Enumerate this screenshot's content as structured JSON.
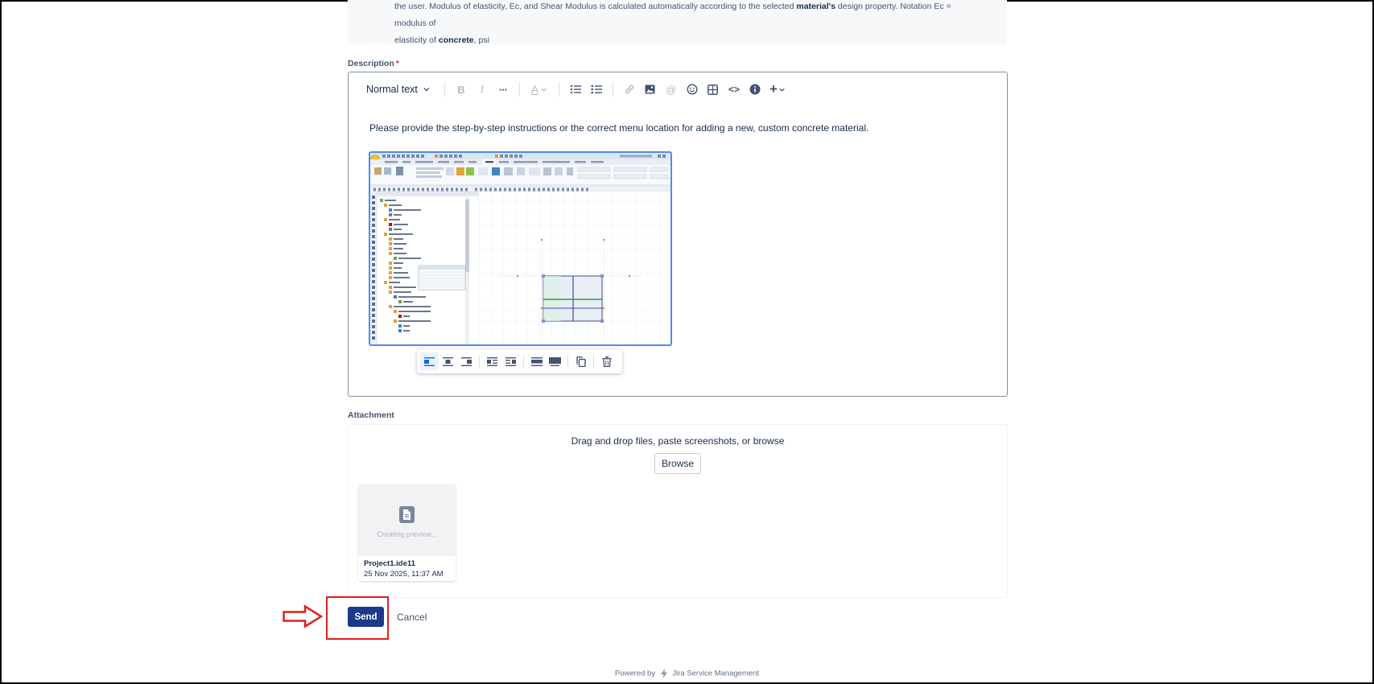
{
  "help": {
    "line1_pre": "the user. Modulus of elasticity, Ec, and Shear Modulus is calculated automatically according to the selected ",
    "line1_bold": "material's",
    "line1_post": " design property. Notation Ec = modulus of",
    "line2_pre": "elasticity of ",
    "line2_bold": "concrete",
    "line2_post": ", psi"
  },
  "description": {
    "label": "Description",
    "required_mark": "*",
    "toolbar": {
      "text_style": "Normal text",
      "bold": "B",
      "italic": "I",
      "more": "···",
      "text_color": "A",
      "mention": "@",
      "code": "<>",
      "insert": "+"
    },
    "body_text": "Please provide the step-by-step instructions or the correct menu location for adding a new, custom concrete material."
  },
  "attachment": {
    "label": "Attachment",
    "drop_text": "Drag and drop files, paste screenshots, or browse",
    "browse_label": "Browse",
    "file": {
      "preview_status": "Creating preview...",
      "name": "Project1.ide11",
      "date": "25 Nov 2025, 11:37 AM"
    }
  },
  "actions": {
    "send_label": "Send",
    "cancel_label": "Cancel"
  },
  "footer": {
    "powered_by": "Powered by",
    "product": "Jira Service Management"
  },
  "colors": {
    "primary_button": "#1d3a8a",
    "annotation_red": "#e01e1e",
    "required": "#c9372c",
    "selection_blue": "#4c8cf5"
  },
  "icons": [
    "chevron-down-icon",
    "bullet-list-icon",
    "numbered-list-icon",
    "link-icon",
    "image-icon",
    "emoji-icon",
    "table-icon",
    "info-icon",
    "align-left-icon",
    "align-center-icon",
    "align-right-icon",
    "wrap-left-icon",
    "wrap-right-icon",
    "width-wide-icon",
    "width-full-icon",
    "copy-icon",
    "trash-icon",
    "file-icon",
    "arrow-right-icon",
    "jira-logo-icon"
  ]
}
